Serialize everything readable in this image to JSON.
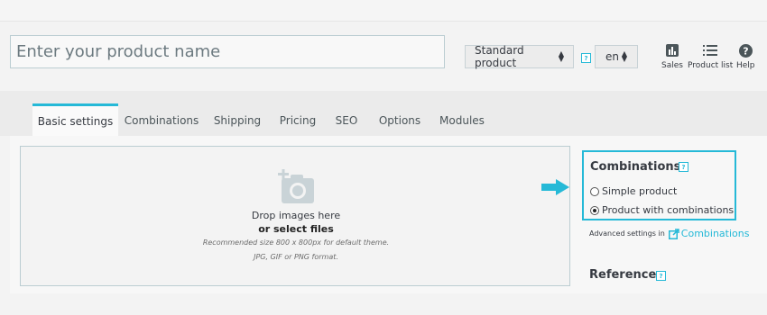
{
  "header": {
    "product_name_placeholder": "Enter your product name",
    "product_type": "Standard product",
    "help_mark": "?",
    "language": "en",
    "tools": [
      {
        "label": "Sales",
        "icon": "bar-chart-icon"
      },
      {
        "label": "Product list",
        "icon": "list-icon"
      },
      {
        "label": "Help",
        "icon": "help-circle-icon"
      }
    ]
  },
  "tabs": [
    {
      "label": "Basic settings",
      "active": true
    },
    {
      "label": "Combinations"
    },
    {
      "label": "Shipping"
    },
    {
      "label": "Pricing"
    },
    {
      "label": "SEO"
    },
    {
      "label": "Options"
    },
    {
      "label": "Modules"
    }
  ],
  "dropzone": {
    "line1": "Drop images here",
    "line2": "or select files",
    "line3": "Recommended size 800 x 800px for default theme.",
    "line4": "JPG, GIF or PNG format.",
    "icon": "add-photo-icon"
  },
  "combinations": {
    "title": "Combinations",
    "option_simple": "Simple product",
    "option_with": "Product with combinations",
    "selected": "Product with combinations",
    "advanced_prefix": "Advanced settings in",
    "advanced_link": "Combinations"
  },
  "reference": {
    "title": "Reference"
  },
  "colors": {
    "accent": "#25b9d7",
    "text": "#363a41"
  }
}
